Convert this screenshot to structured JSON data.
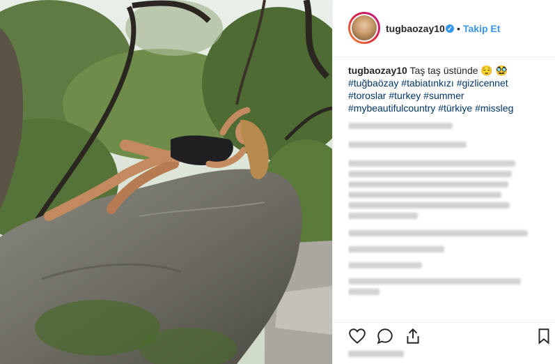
{
  "post": {
    "username": "tugbaozay10",
    "verified": true,
    "separator": "•",
    "follow_label": "Takip Et",
    "caption_user": "tugbaozay10",
    "caption_text": "Taş taş üstünde",
    "caption_emojis": "😌 🥸",
    "hashtags_line1": [
      "#tuğbaözay",
      "#tabiatınkızı",
      "#gizlicennet"
    ],
    "hashtags_line2": [
      "#toroslar",
      "#turkey",
      "#summer"
    ],
    "hashtags_line3": [
      "#mybeautifulcountry",
      "#türkiye",
      "#missleg"
    ]
  },
  "actions": {
    "like_icon": "heart-icon",
    "comment_icon": "comment-icon",
    "share_icon": "share-icon",
    "save_icon": "bookmark-icon"
  },
  "colors": {
    "link": "#3897f0",
    "hashtag": "#003569",
    "text": "#262626",
    "border": "#efefef"
  }
}
